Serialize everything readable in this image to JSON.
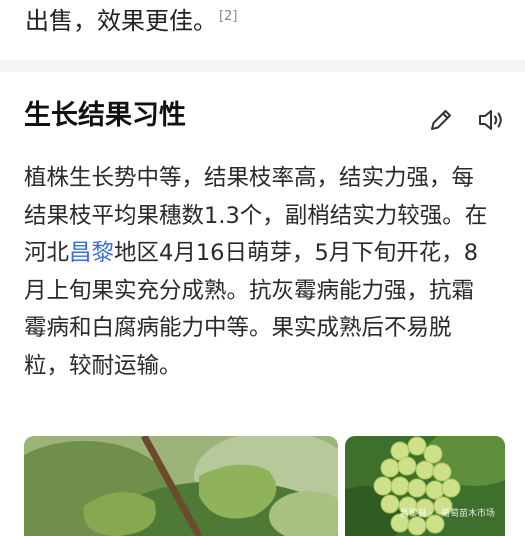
{
  "top": {
    "text": "出售，效果更佳。",
    "ref": "[2]"
  },
  "section": {
    "title": "生长结果习性",
    "edit_icon": "pencil-icon",
    "audio_icon": "speaker-icon",
    "lines": [
      {
        "pre": "植株生长势中等，结果枝率高，结实力强，每"
      },
      {
        "pre": "结果枝平均果穗数1.3个，副梢结实力较强。在"
      },
      {
        "pre": "河北",
        "link": "昌黎",
        "post": "地区4月16日萌芽，5月下旬开花，8"
      },
      {
        "pre": "月上旬果实充分成熟。抗灰霉病能力强，抗霜"
      },
      {
        "pre": "霉病和白腐病能力中等。果实成熟后不易脱"
      },
      {
        "pre": "粒，较耐运输。"
      }
    ],
    "photo_right_watermark": "昌黎县 · · 葡萄苗木市场"
  },
  "colors": {
    "link": "#3b6fd1",
    "divider": "#f4f5f7",
    "text": "#2a2a2a"
  }
}
